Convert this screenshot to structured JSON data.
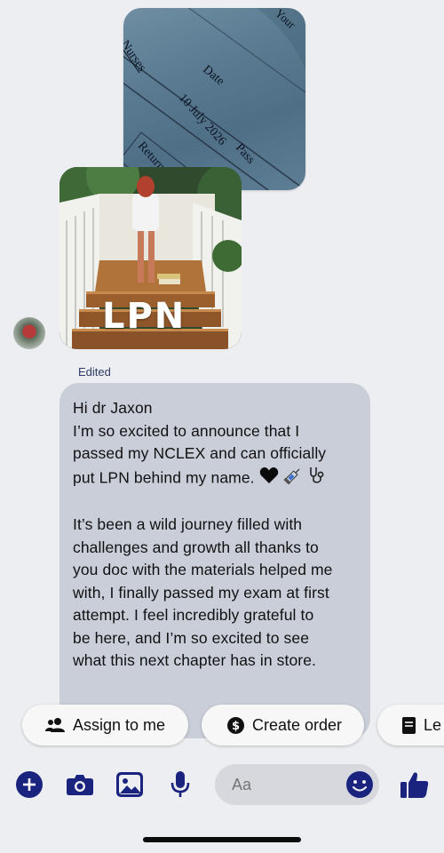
{
  "photo_top": {
    "text_nurses": "Nurses",
    "text_date": "Date",
    "text_date_value": "10 July 2026",
    "text_pass": "Pass",
    "text_return": "Return to Do",
    "text_corner": "Your"
  },
  "photo_main": {
    "sign_text": "LPN"
  },
  "message": {
    "edited_label": "Edited",
    "lines": [
      "Hi dr Jaxon",
      "I’m so excited to announce that I",
      "passed my NCLEX and can officially",
      "put LPN behind my name."
    ],
    "emojis": [
      "black-heart",
      "syringe",
      "stethoscope"
    ],
    "paragraph2": [
      "It’s been a wild journey filled with",
      "challenges and growth all thanks to",
      "you doc with the materials helped me",
      "with, I finally passed my exam at first",
      "attempt. I feel incredibly grateful to",
      "be here, and I’m so excited to see",
      "what this next chapter has in store."
    ]
  },
  "quick_replies": {
    "assign_label": "Assign to me",
    "create_order_label": "Create order",
    "third_label": "Le"
  },
  "composer": {
    "placeholder": "Aa"
  },
  "colors": {
    "accent": "#1a237e",
    "bubble": "#c9ced8",
    "background": "#eceef1"
  },
  "icons": {
    "bottom_bar": [
      "plus-circle-icon",
      "camera-icon",
      "gallery-icon",
      "microphone-icon",
      "emoji-icon",
      "thumbs-up-icon"
    ]
  }
}
